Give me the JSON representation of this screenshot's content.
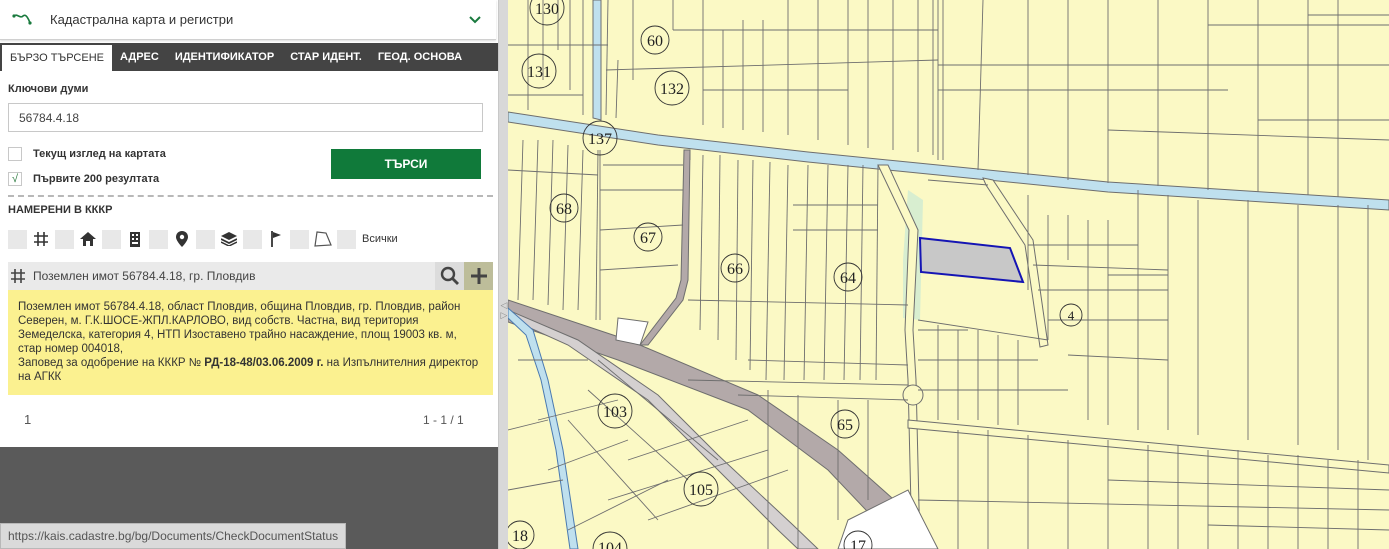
{
  "layer_selector": {
    "label": "Кадастрална карта и регистри"
  },
  "tabs": [
    {
      "label": "БЪРЗО ТЪРСЕНЕ"
    },
    {
      "label": "АДРЕС"
    },
    {
      "label": "ИДЕНТИФИКАТОР"
    },
    {
      "label": "СТАР ИДЕНТ."
    },
    {
      "label": "ГЕОД. ОСНОВА"
    }
  ],
  "search": {
    "keywords_label": "Ключови думи",
    "keywords_value": "56784.4.18",
    "current_view_label": "Текущ изглед на картата",
    "current_view_checked": false,
    "first200_label": "Първите 200 резултата",
    "first200_checked": true,
    "first200_mark": "√",
    "search_button": "ТЪРСИ"
  },
  "found": {
    "title": "НАМЕРЕНИ В КККР",
    "filter_all_label": "Всички",
    "filter_icons": [
      "grid-icon",
      "house-icon",
      "building-icon",
      "location-pin-icon",
      "layers-icon",
      "flag-icon",
      "polygon-icon"
    ]
  },
  "result": {
    "title": "Поземлен имот 56784.4.18, гр. Пловдив",
    "detail_line1": "Поземлен имот 56784.4.18, област Пловдив, община Пловдив, гр. Пловдив, район Северен, м. Г.К.ШОСЕ-ЖПЛ.КАРЛОВО, вид собств. Частна, вид територия Земеделска, категория 4, НТП Изоставено трайно насаждение, площ 19003 кв. м, стар номер 004018,",
    "detail_order_prefix": "Заповед за одобрение на КККР № ",
    "detail_order_number": "РД-18-48/03.06.2009 г.",
    "detail_order_suffix": " на Изпълнителния директор на АГКК"
  },
  "pager": {
    "page": "1",
    "range": "1 - 1 / 1"
  },
  "status_bar": {
    "url": "https://kais.cadastre.bg/bg/Documents/CheckDocumentStatus"
  },
  "map": {
    "labels": [
      "130",
      "60",
      "131",
      "132",
      "137",
      "68",
      "67",
      "66",
      "64",
      "4",
      "103",
      "65",
      "105",
      "18",
      "104",
      "17"
    ],
    "colors": {
      "parcel_fill": "#fbf9c5",
      "parcel_line": "#6e6e6e",
      "road": "#b3a9a9",
      "water": "#bfe0ee",
      "highlight_fill": "#c8c8c8",
      "highlight_stroke": "#1515b4",
      "green": "#d8eed0"
    }
  }
}
